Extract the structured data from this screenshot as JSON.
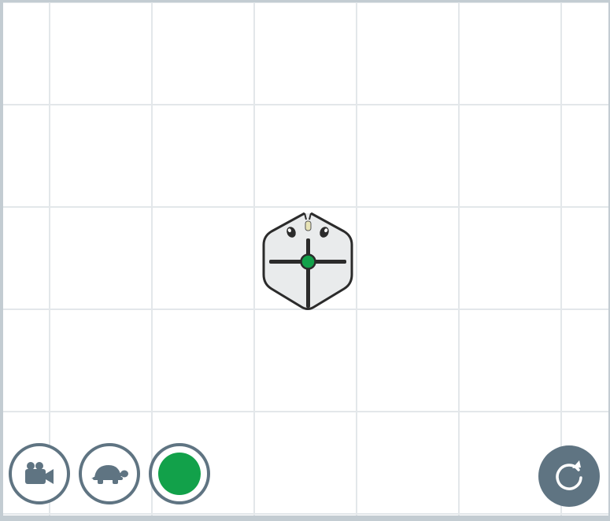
{
  "colors": {
    "background": "#ffffff",
    "grid_line": "#e3e7ea",
    "frame": "#c3ccd2",
    "control_gray": "#5f7482",
    "pen_color": "#12a14a",
    "robot_body": "#e9ebec",
    "robot_outline": "#2b2b2b",
    "robot_marker": "#12a14a"
  },
  "canvas": {
    "grid": "on"
  },
  "robot": {
    "icon": "hexagon-robot-icon",
    "marker_color": "#12a14a"
  },
  "controls": {
    "camera": {
      "icon": "video-camera-icon"
    },
    "speed": {
      "icon": "turtle-icon"
    },
    "pen": {
      "icon": "pen-color-swatch",
      "color": "#12a14a"
    },
    "reset": {
      "icon": "reset-rotate-icon"
    }
  }
}
